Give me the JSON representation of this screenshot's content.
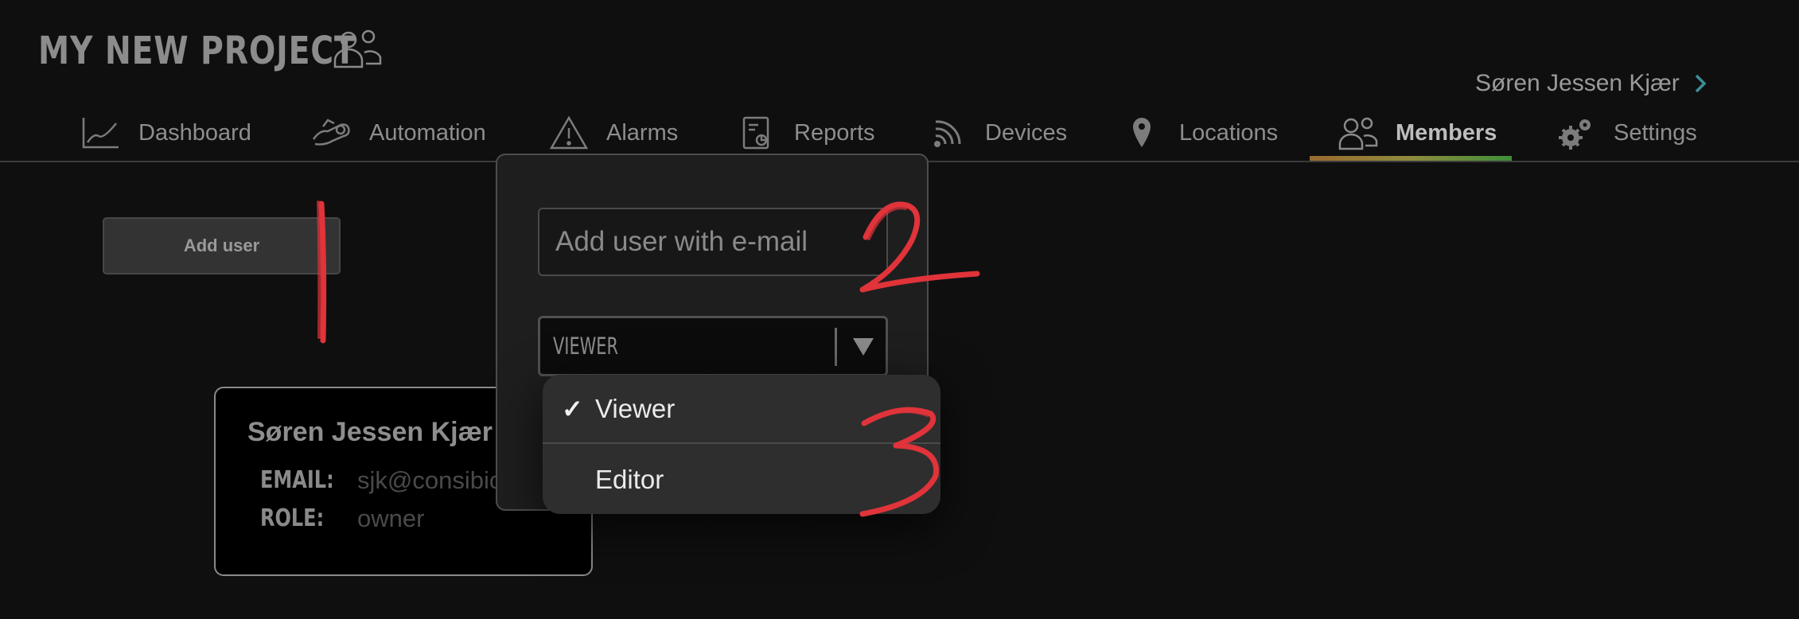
{
  "header": {
    "project_title": "MY NEW PROJECT",
    "current_user": "Søren Jessen Kjær"
  },
  "nav": {
    "items": [
      {
        "label": "Dashboard",
        "icon": "chart-line-icon"
      },
      {
        "label": "Automation",
        "icon": "hand-gear-icon"
      },
      {
        "label": "Alarms",
        "icon": "warning-triangle-icon"
      },
      {
        "label": "Reports",
        "icon": "report-document-icon"
      },
      {
        "label": "Devices",
        "icon": "wireless-signal-icon"
      },
      {
        "label": "Locations",
        "icon": "map-pin-icon"
      },
      {
        "label": "Members",
        "icon": "members-icon"
      },
      {
        "label": "Settings",
        "icon": "gears-icon"
      }
    ],
    "active": "Members"
  },
  "main": {
    "add_user_label": "Add user"
  },
  "member_card": {
    "name": "Søren Jessen Kjær",
    "email_label": "EMAIL:",
    "email_value": "sjk@consibio",
    "role_label": "ROLE:",
    "role_value": "owner"
  },
  "add_user_modal": {
    "email_placeholder": "Add user with e-mail",
    "role_selected": "VIEWER"
  },
  "role_dropdown": {
    "options": [
      {
        "label": "Viewer",
        "checked": true
      },
      {
        "label": "Editor",
        "checked": false
      }
    ]
  },
  "annotations": {
    "markers": [
      "1",
      "2",
      "3"
    ],
    "color": "#e0333a"
  },
  "colors": {
    "background": "#0f0f0f",
    "active_underline_start": "#9a6a2f",
    "active_underline_end": "#3f8e3a"
  }
}
